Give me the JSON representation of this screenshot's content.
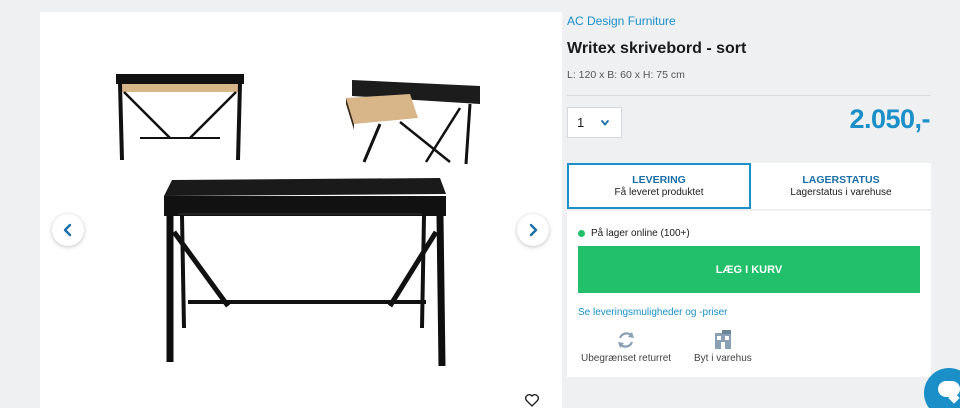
{
  "product": {
    "brand": "AC Design Furniture",
    "title": "Writex skrivebord - sort",
    "dimensions": "L: 120 x B: 60 x H: 75 cm",
    "quantity": "1",
    "price": "2.050,-"
  },
  "tabs": [
    {
      "title": "LEVERING",
      "subtitle": "Få leveret produktet",
      "active": true
    },
    {
      "title": "LAGERSTATUS",
      "subtitle": "Lagerstatus i varehuse",
      "active": false
    }
  ],
  "stock": {
    "text": "På lager online (100+)",
    "color": "#22c06a"
  },
  "cart_button": "LÆG I KURV",
  "delivery_link": "Se leveringsmuligheder og -priser",
  "features": [
    {
      "label": "Ubegrænset returret",
      "icon": "return-icon"
    },
    {
      "label": "Byt i varehus",
      "icon": "store-exchange-icon"
    }
  ],
  "colors": {
    "accent": "#1a8fc8",
    "cta": "#22c06a"
  }
}
